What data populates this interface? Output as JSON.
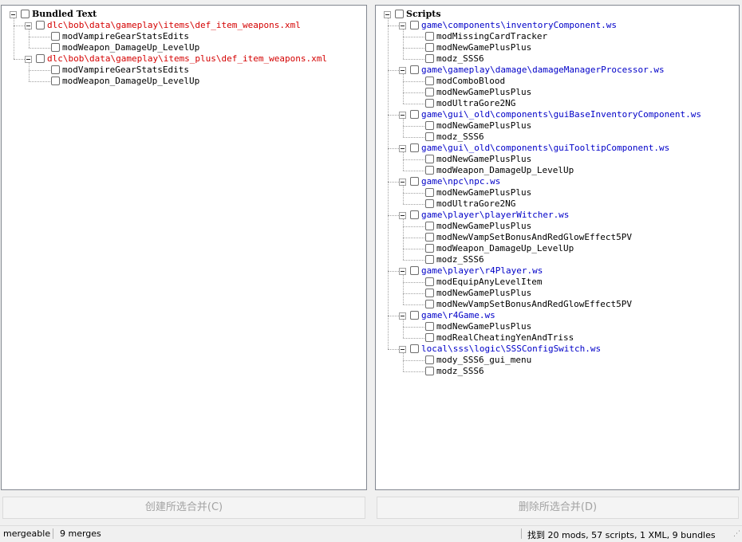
{
  "left_tree": {
    "root": "Bundled Text",
    "groups": [
      {
        "path": "dlc\\bob\\data\\gameplay\\items\\def_item_weapons.xml",
        "items": [
          "modVampireGearStatsEdits",
          "modWeapon_DamageUp_LevelUp"
        ]
      },
      {
        "path": "dlc\\bob\\data\\gameplay\\items_plus\\def_item_weapons.xml",
        "items": [
          "modVampireGearStatsEdits",
          "modWeapon_DamageUp_LevelUp"
        ]
      }
    ]
  },
  "right_tree": {
    "root": "Scripts",
    "groups": [
      {
        "path": "game\\components\\inventoryComponent.ws",
        "items": [
          "modMissingCardTracker",
          "modNewGamePlusPlus",
          "modz_SSS6"
        ]
      },
      {
        "path": "game\\gameplay\\damage\\damageManagerProcessor.ws",
        "items": [
          "modComboBlood",
          "modNewGamePlusPlus",
          "modUltraGore2NG"
        ]
      },
      {
        "path": "game\\gui\\_old\\components\\guiBaseInventoryComponent.ws",
        "items": [
          "modNewGamePlusPlus",
          "modz_SSS6"
        ]
      },
      {
        "path": "game\\gui\\_old\\components\\guiTooltipComponent.ws",
        "items": [
          "modNewGamePlusPlus",
          "modWeapon_DamageUp_LevelUp"
        ]
      },
      {
        "path": "game\\npc\\npc.ws",
        "items": [
          "modNewGamePlusPlus",
          "modUltraGore2NG"
        ]
      },
      {
        "path": "game\\player\\playerWitcher.ws",
        "items": [
          "modNewGamePlusPlus",
          "modNewVampSetBonusAndRedGlowEffect5PV",
          "modWeapon_DamageUp_LevelUp",
          "modz_SSS6"
        ]
      },
      {
        "path": "game\\player\\r4Player.ws",
        "items": [
          "modEquipAnyLevelItem",
          "modNewGamePlusPlus",
          "modNewVampSetBonusAndRedGlowEffect5PV"
        ]
      },
      {
        "path": "game\\r4Game.ws",
        "items": [
          "modNewGamePlusPlus",
          "modRealCheatingYenAndTriss"
        ]
      },
      {
        "path": "local\\sss\\logic\\SSSConfigSwitch.ws",
        "items": [
          "mody_SSS6_gui_menu",
          "modz_SSS6"
        ]
      }
    ]
  },
  "buttons": {
    "create_merge": "创建所选合并(C)",
    "delete_merge": "删除所选合并(D)"
  },
  "statusbar": {
    "mergeable": "mergeable",
    "merges": "9 merges",
    "summary": "找到 20 mods, 57 scripts, 1 XML, 9 bundles"
  },
  "colors": {
    "xml_path": "#d40000",
    "script_path": "#0000c8"
  }
}
